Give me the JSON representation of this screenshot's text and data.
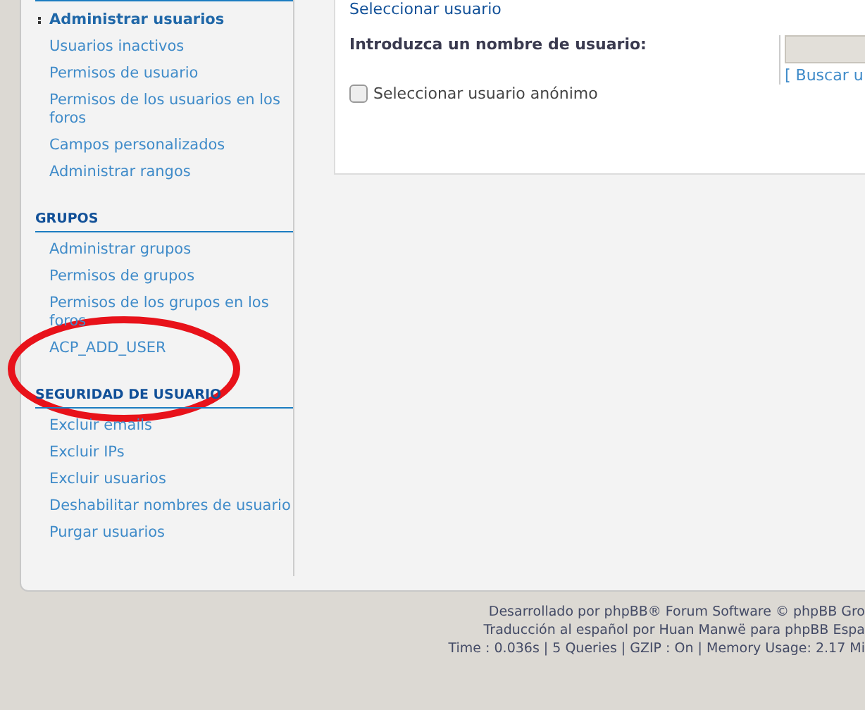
{
  "sidebar": {
    "sections": [
      {
        "items": [
          {
            "label": "Administrar usuarios",
            "selected": true
          },
          {
            "label": "Usuarios inactivos",
            "selected": false
          },
          {
            "label": "Permisos de usuario",
            "selected": false
          },
          {
            "label": "Permisos de los usuarios en los foros",
            "selected": false
          },
          {
            "label": "Campos personalizados",
            "selected": false
          },
          {
            "label": "Administrar rangos",
            "selected": false
          }
        ]
      },
      {
        "title": "GRUPOS",
        "items": [
          {
            "label": "Administrar grupos",
            "selected": false
          },
          {
            "label": "Permisos de grupos",
            "selected": false
          },
          {
            "label": "Permisos de los grupos en los foros",
            "selected": false
          },
          {
            "label": "ACP_ADD_USER",
            "selected": false
          }
        ]
      },
      {
        "title": "SEGURIDAD DE USUARIO",
        "items": [
          {
            "label": "Excluir emails",
            "selected": false
          },
          {
            "label": "Excluir IPs",
            "selected": false
          },
          {
            "label": "Excluir usuarios",
            "selected": false
          },
          {
            "label": "Deshabilitar nombres de usuario",
            "selected": false
          },
          {
            "label": "Purgar usuarios",
            "selected": false
          }
        ]
      }
    ]
  },
  "form": {
    "legend": "Seleccionar usuario",
    "label": "Introduzca un nombre de usuario:",
    "find_link": "[ Buscar u",
    "anonymous": {
      "label": "Seleccionar usuario anónimo",
      "checked": false
    }
  },
  "footer": [
    "Desarrollado por phpBB® Forum Software © phpBB Gro",
    "Traducción al español por Huan Manwë para phpBB Espa",
    "Time : 0.036s | 5 Queries | GZIP : On | Memory Usage: 2.17 Mi"
  ]
}
